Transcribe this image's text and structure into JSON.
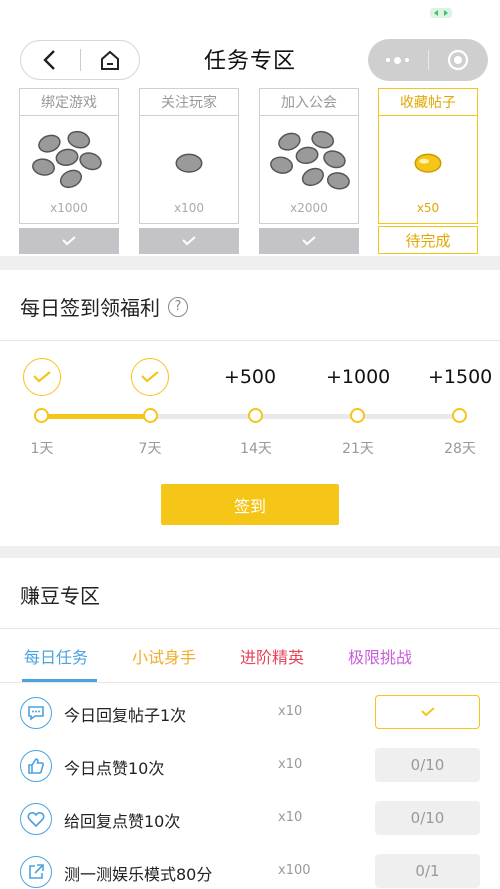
{
  "header": {
    "title": "任务专区"
  },
  "task_cards": [
    {
      "title": "绑定游戏",
      "qty": "x1000",
      "status": "done"
    },
    {
      "title": "关注玩家",
      "qty": "x100",
      "status": "done"
    },
    {
      "title": "加入公会",
      "qty": "x2000",
      "status": "done"
    },
    {
      "title": "收藏帖子",
      "qty": "x50",
      "status": "pending",
      "status_label": "待完成"
    }
  ],
  "sign_in": {
    "title": "每日签到领福利",
    "help": "?",
    "rewards": [
      "",
      "",
      "+500",
      "+1000",
      "+1500"
    ],
    "days": [
      "1天",
      "7天",
      "14天",
      "21天",
      "28天"
    ],
    "progress": 0.25,
    "button_label": "签到"
  },
  "earn": {
    "title": "赚豆专区",
    "tabs": [
      {
        "label": "每日任务",
        "color": "#4aa3df",
        "active": true
      },
      {
        "label": "小试身手",
        "color": "#f0ad2a"
      },
      {
        "label": "进阶精英",
        "color": "#e6435a"
      },
      {
        "label": "极限挑战",
        "color": "#c65ed8"
      }
    ],
    "tasks": [
      {
        "icon": "comment-icon",
        "label": "今日回复帖子1次",
        "reward": "x10",
        "status": ""
      },
      {
        "icon": "thumbs-up-icon",
        "label": "今日点赞10次",
        "reward": "x10",
        "status": "0/10"
      },
      {
        "icon": "heart-icon",
        "label": "给回复点赞10次",
        "reward": "x10",
        "status": "0/10"
      },
      {
        "icon": "share-icon",
        "label": "测一测娱乐模式80分",
        "reward": "x100",
        "status": "0/1"
      }
    ]
  },
  "colors": {
    "accent": "#f5c518",
    "blue": "#4aa3df",
    "gray_button": "#c4c4c8"
  }
}
